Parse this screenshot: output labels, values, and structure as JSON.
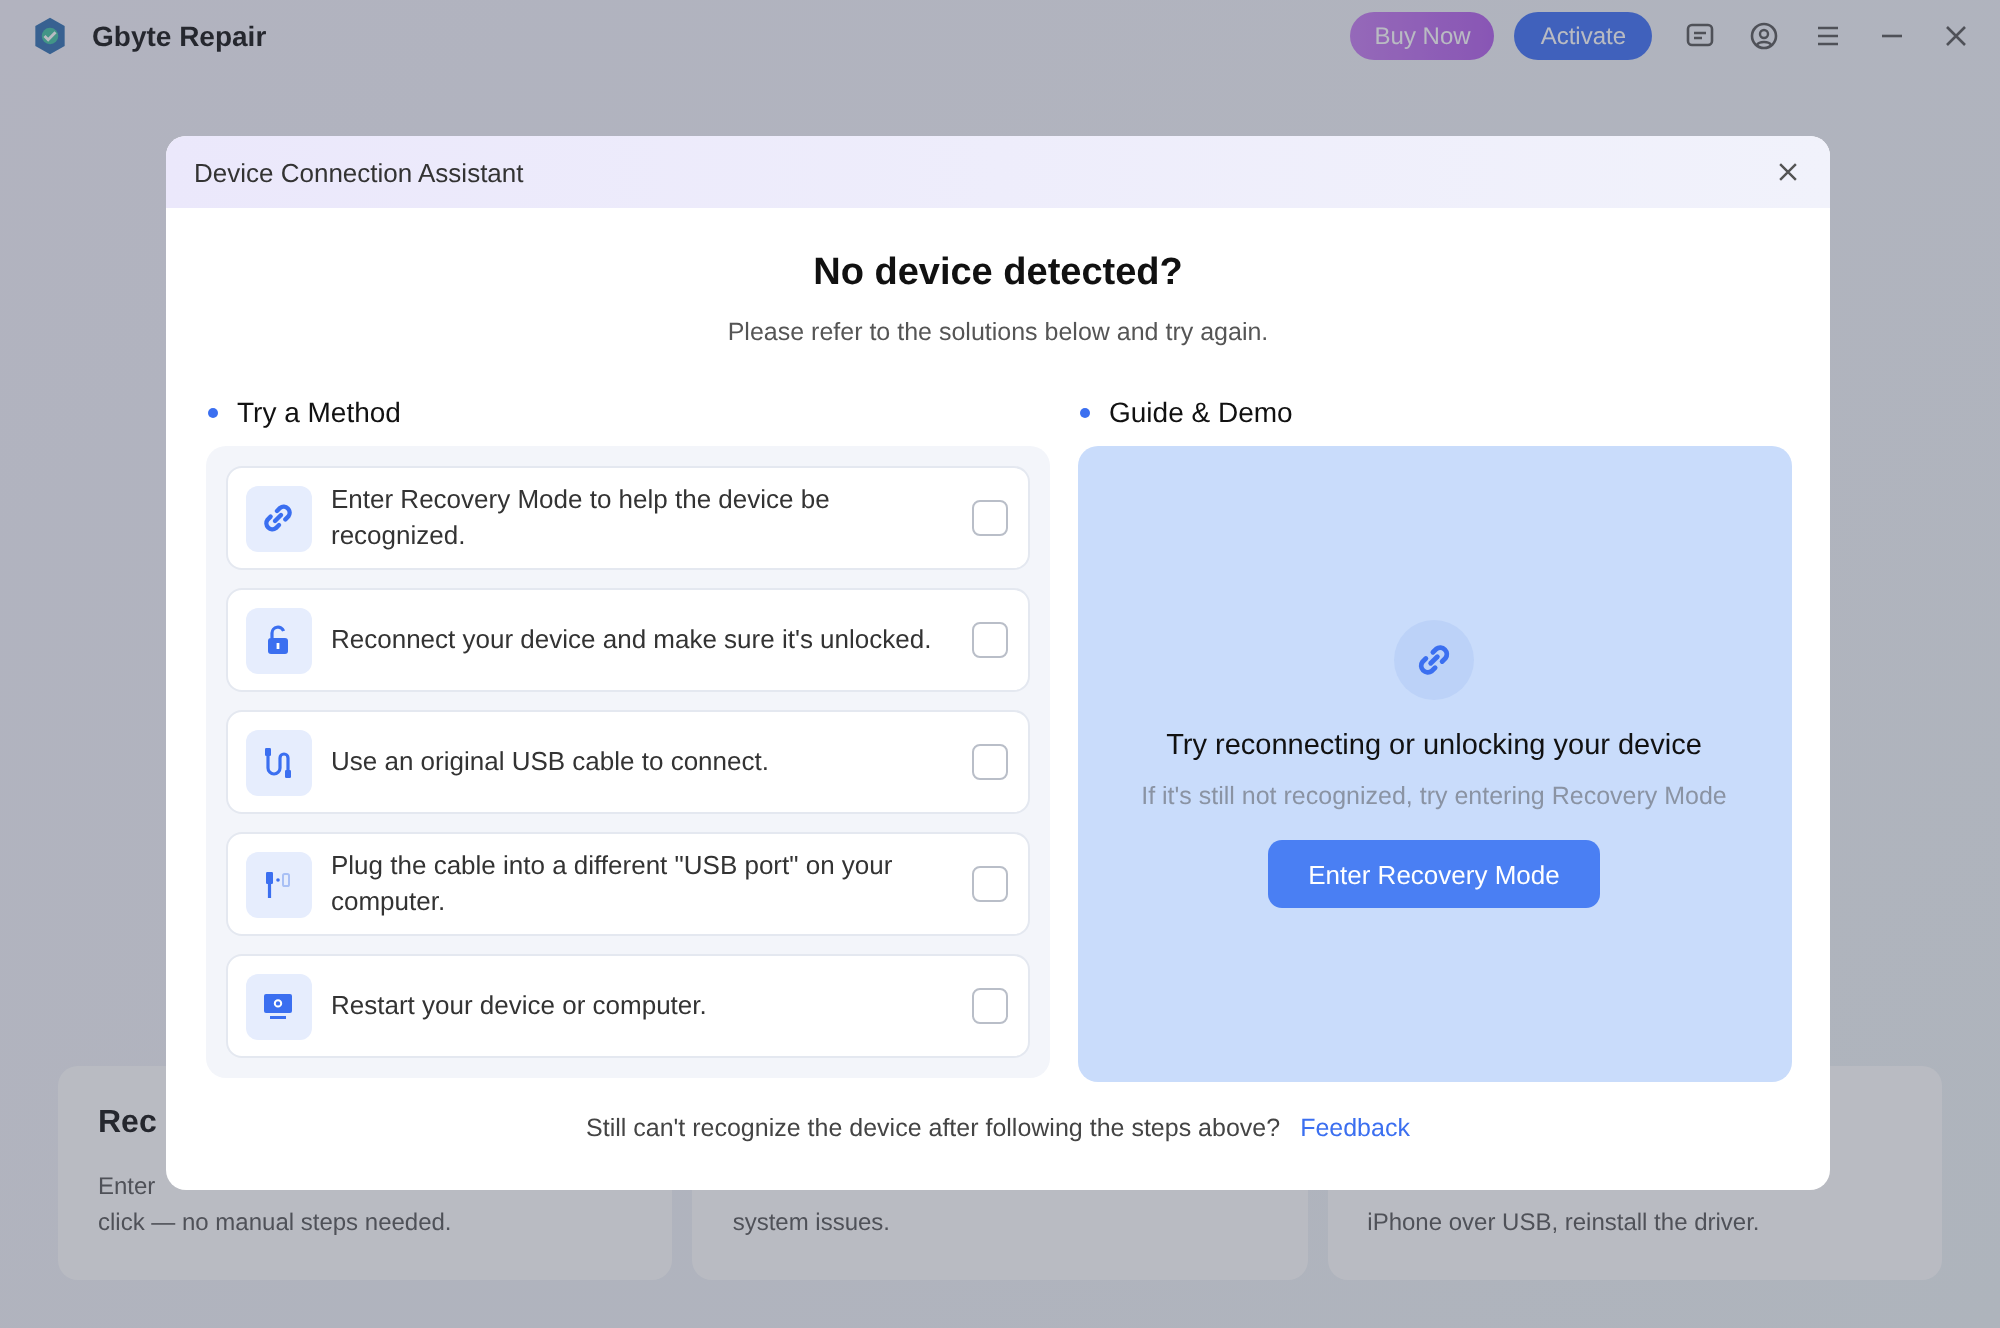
{
  "app": {
    "title": "Gbyte Repair",
    "buy_button": "Buy Now",
    "activate_button": "Activate"
  },
  "background_cards": [
    {
      "title": "Rec",
      "description": [
        "Enter",
        "click — no manual steps needed."
      ]
    },
    {
      "description": [
        "system issues."
      ]
    },
    {
      "description": [
        "iPhone over USB, reinstall the driver."
      ]
    }
  ],
  "dialog": {
    "title": "Device Connection Assistant",
    "heading": "No device detected?",
    "subtitle": "Please refer to the solutions below and try again.",
    "methods_label": "Try a Method",
    "methods": [
      {
        "kind": "link",
        "text": "Enter Recovery Mode to help the device be recognized.",
        "checked": false
      },
      {
        "kind": "lock",
        "text": "Reconnect your device and make sure it's unlocked.",
        "checked": false
      },
      {
        "kind": "cable",
        "text": "Use an original USB cable to connect.",
        "checked": false
      },
      {
        "kind": "port",
        "text": "Plug the cable into a different \"USB port\" on your computer.",
        "checked": false
      },
      {
        "kind": "monitor",
        "text": "Restart your device or computer.",
        "checked": false
      }
    ],
    "guide_label": "Guide & Demo",
    "guide": {
      "heading": "Try reconnecting or unlocking your device",
      "text": "If it's still not recognized, try entering Recovery Mode",
      "button": "Enter Recovery Mode"
    },
    "footer_text": "Still can't recognize the device after following the steps above?",
    "footer_link": "Feedback"
  }
}
